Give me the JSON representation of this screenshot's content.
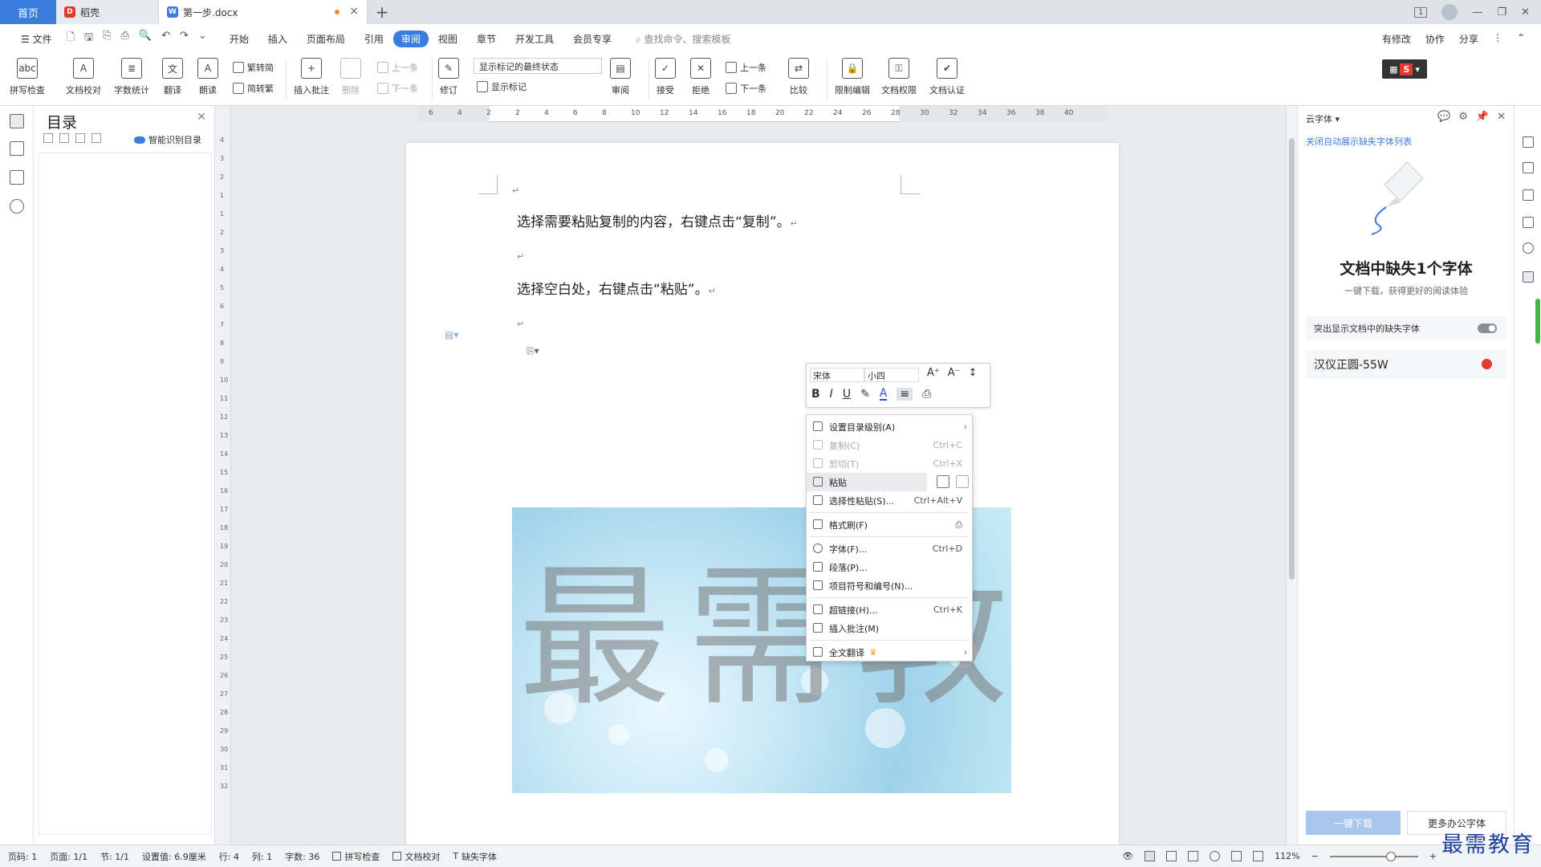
{
  "titlebar": {
    "home": "首页",
    "tabs": [
      {
        "label": "稻壳"
      },
      {
        "label": "第一步.docx"
      }
    ],
    "add": "+",
    "controls": [
      "1",
      "—",
      "❐",
      "✕"
    ]
  },
  "menu": {
    "file": "☰ 文件",
    "items": [
      "开始",
      "插入",
      "页面布局",
      "引用",
      "审阅",
      "视图",
      "章节",
      "开发工具",
      "会员专享"
    ],
    "active": "审阅",
    "search_placeholder": "查找命令、搜索模板",
    "right": [
      "有修改",
      "协作",
      "分享"
    ]
  },
  "ribbon": {
    "spell": "拼写检查",
    "proof": "文档校对",
    "wordcount": "字数统计",
    "translate": "翻译",
    "read": "朗读",
    "to_traditional": "繁转简",
    "to_simplified": "简转繁",
    "insert_comment": "插入批注",
    "delete": "删除",
    "prev": "上一条",
    "next": "下一条",
    "track": "修订",
    "markup_state": "显示标记的最终状态",
    "show_markup": "显示标记",
    "review": "审阅",
    "accept": "接受",
    "reject": "拒绝",
    "prev2": "上一条",
    "next2": "下一条",
    "compare": "比较",
    "restrict": "限制编辑",
    "permission": "文档权限",
    "certify": "文档认证",
    "wps_badge": "S"
  },
  "toc": {
    "title": "目录",
    "smart": "智能识别目录"
  },
  "ruler": {
    "h_ticks": [
      "6",
      "4",
      "2",
      "2",
      "4",
      "6",
      "8",
      "10",
      "12",
      "14",
      "16",
      "18",
      "20",
      "22",
      "24",
      "26",
      "28",
      "30",
      "32",
      "34",
      "36",
      "38",
      "40"
    ],
    "v_ticks": [
      "4",
      "3",
      "2",
      "1",
      "1",
      "2",
      "3",
      "4",
      "5",
      "6",
      "7",
      "8",
      "9",
      "10",
      "11",
      "12",
      "13",
      "14",
      "15",
      "16",
      "17",
      "18",
      "19",
      "20",
      "21",
      "22",
      "23",
      "24",
      "25",
      "26",
      "27",
      "28",
      "29",
      "30",
      "31",
      "32"
    ]
  },
  "document": {
    "para1": "选择需要粘贴复制的内容，右键点击“复制”。",
    "para2": "选择空白处，右键点击“粘贴”。",
    "return_mark": "↵",
    "watermark": "最需教育"
  },
  "mini_toolbar": {
    "font": "宋体",
    "size": "小四",
    "grow": "A⁺",
    "shrink": "A⁻",
    "spacing": "↕",
    "bold": "B",
    "italic": "I",
    "underline": "U",
    "highlight": "✎",
    "font_color": "A",
    "align": "≡",
    "painter": "⎙"
  },
  "context_menu": {
    "items": [
      {
        "label": "设置目录级别(A)",
        "shortcut": "",
        "arrow": "›",
        "disabled": false
      },
      {
        "label": "复制(C)",
        "shortcut": "Ctrl+C",
        "arrow": "",
        "disabled": true
      },
      {
        "label": "剪切(T)",
        "shortcut": "Ctrl+X",
        "arrow": "",
        "disabled": true
      },
      {
        "label": "粘贴",
        "shortcut": "",
        "arrow": "",
        "disabled": false
      },
      {
        "label": "选择性粘贴(S)...",
        "shortcut": "Ctrl+Alt+V",
        "arrow": "",
        "disabled": false
      },
      {
        "label": "格式刷(F)",
        "shortcut": "",
        "arrow": "",
        "disabled": false
      },
      {
        "label": "字体(F)...",
        "shortcut": "Ctrl+D",
        "arrow": "",
        "disabled": false
      },
      {
        "label": "段落(P)...",
        "shortcut": "",
        "arrow": "",
        "disabled": false
      },
      {
        "label": "项目符号和编号(N)...",
        "shortcut": "",
        "arrow": "",
        "disabled": false
      },
      {
        "label": "超链接(H)...",
        "shortcut": "Ctrl+K",
        "arrow": "",
        "disabled": false
      },
      {
        "label": "插入批注(M)",
        "shortcut": "",
        "arrow": "",
        "disabled": false
      },
      {
        "label": "全文翻译",
        "shortcut": "",
        "arrow": "›",
        "disabled": false
      }
    ],
    "crown": "♛"
  },
  "right_panel": {
    "header": "云字体",
    "link": "关闭自动展示缺失字体列表",
    "headline": "文档中缺失1个字体",
    "subline": "一键下载，获得更好的阅读体验",
    "toggle_label": "突出显示文档中的缺失字体",
    "missing_font": "汉仪正圆-55W",
    "download": "一键下载",
    "more": "更多办公字体"
  },
  "status": {
    "page_num": "页码: 1",
    "pages": "页面: 1/1",
    "section": "节: 1/1",
    "setting": "设置值: 6.9厘米",
    "row": "行: 4",
    "col": "列: 1",
    "words": "字数: 36",
    "spell": "拼写检查",
    "proof": "文档校对",
    "missing_font": "缺失字体",
    "zoom": "112%",
    "minus": "−",
    "plus": "+"
  },
  "brand": "最需教育",
  "colors": {
    "accent": "#3b7ddd",
    "brand": "#1a3f9c",
    "active_dot": "#f08c1a"
  }
}
